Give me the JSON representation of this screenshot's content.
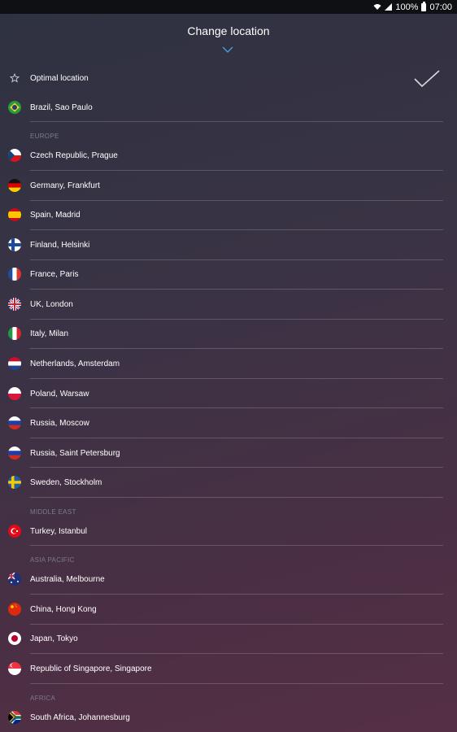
{
  "status_bar": {
    "battery": "100%",
    "time": "07:00"
  },
  "header": {
    "title": "Change location"
  },
  "colors": {
    "background_top": "#2e3240",
    "background_bottom": "#552f45",
    "section_text": "#7a7c88",
    "accent": "#4aa3df"
  },
  "locations": {
    "optimal": "Optimal location",
    "brazil": "Brazil, Sao Paulo"
  },
  "sections": {
    "europe": {
      "title": "EUROPE",
      "items": [
        "Czech Republic, Prague",
        "Germany, Frankfurt",
        "Spain, Madrid",
        "Finland, Helsinki",
        "France, Paris",
        "UK, London",
        "Italy, Milan",
        "Netherlands, Amsterdam",
        "Poland, Warsaw",
        "Russia, Moscow",
        "Russia, Saint Petersburg",
        "Sweden, Stockholm"
      ]
    },
    "middle_east": {
      "title": "MIDDLE EAST",
      "items": [
        "Turkey, Istanbul"
      ]
    },
    "asia_pacific": {
      "title": "ASIA PACIFIC",
      "items": [
        "Australia, Melbourne",
        "China, Hong Kong",
        "Japan, Tokyo",
        "Republic of Singapore, Singapore"
      ]
    },
    "africa": {
      "title": "AFRICA",
      "items": [
        "South Africa, Johannesburg"
      ]
    }
  },
  "icons": {
    "selected": "checkmark-icon",
    "optimal": "star-icon",
    "collapse": "chevron-down-icon"
  }
}
